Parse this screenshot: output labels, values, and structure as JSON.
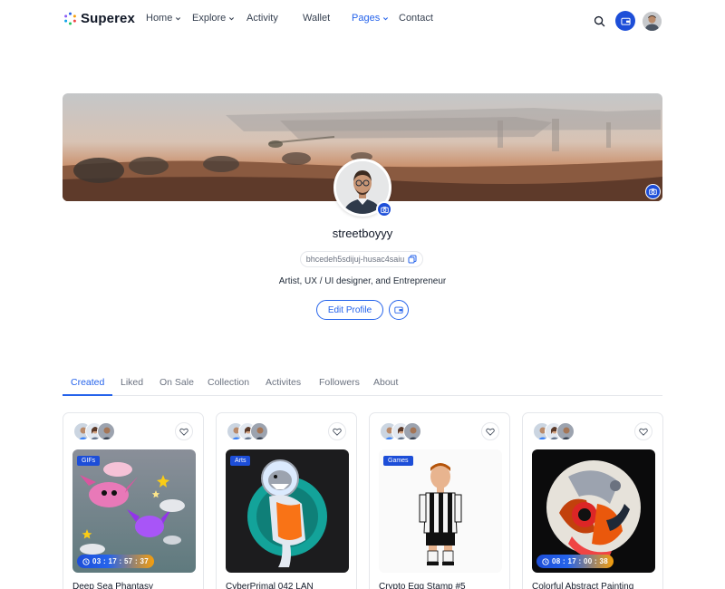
{
  "brand": {
    "name": "Superex",
    "accent": "#2563eb"
  },
  "nav": {
    "items": [
      {
        "label": "Home",
        "dropdown": true,
        "active": false
      },
      {
        "label": "Explore",
        "dropdown": true,
        "active": false
      },
      {
        "label": "Activity",
        "dropdown": false,
        "active": false
      },
      {
        "label": "Wallet",
        "dropdown": false,
        "active": false
      },
      {
        "label": "Pages",
        "dropdown": true,
        "active": true
      },
      {
        "label": "Contact",
        "dropdown": false,
        "active": false
      }
    ]
  },
  "header_actions": {
    "icons": [
      "search-icon",
      "wallet-icon",
      "user-avatar"
    ]
  },
  "profile": {
    "username": "streetboyyy",
    "wallet_address": "bhcedeh5sdijuj-husac4saiu",
    "bio": "Artist, UX / UI designer, and Entrepreneur",
    "edit_label": "Edit Profile"
  },
  "tabs": [
    {
      "label": "Created",
      "active": true
    },
    {
      "label": "Liked",
      "active": false
    },
    {
      "label": "On Sale",
      "active": false
    },
    {
      "label": "Collection",
      "active": false
    },
    {
      "label": "Activites",
      "active": false
    },
    {
      "label": "Followers",
      "active": false
    },
    {
      "label": "About",
      "active": false
    }
  ],
  "cards": [
    {
      "category": "GIFs",
      "timer": "03 : 17 : 57 : 37",
      "title": "Deep Sea Phantasy"
    },
    {
      "category": "Arts",
      "timer": "",
      "title": "CyberPrimal 042 LAN"
    },
    {
      "category": "Games",
      "timer": "",
      "title": "Crypto Egg Stamp #5"
    },
    {
      "category": "",
      "timer": "08 : 17 : 00 : 38",
      "title": "Colorful Abstract Painting"
    }
  ]
}
